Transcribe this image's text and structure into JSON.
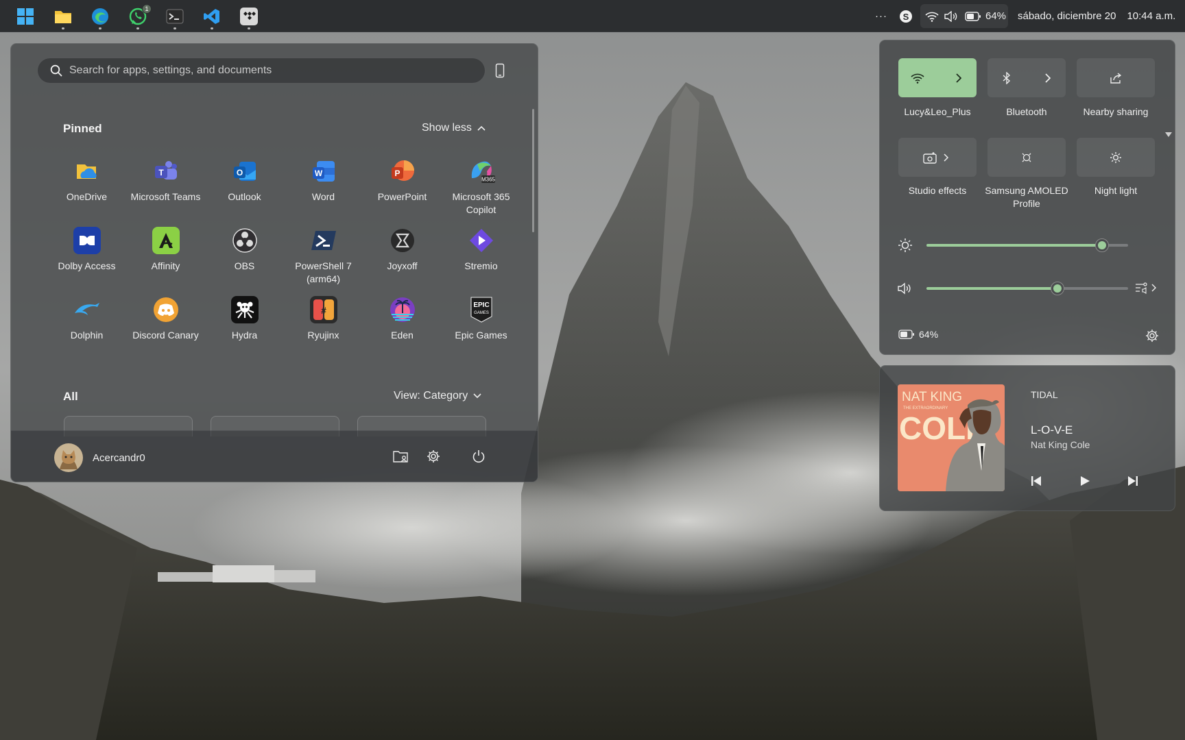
{
  "taskbar": {
    "apps": [
      {
        "name": "Start",
        "icon": "windows-logo-icon"
      },
      {
        "name": "File Explorer",
        "icon": "folder-icon"
      },
      {
        "name": "Microsoft Edge",
        "icon": "edge-icon"
      },
      {
        "name": "WhatsApp",
        "icon": "whatsapp-icon",
        "badge": "1"
      },
      {
        "name": "Terminal",
        "icon": "terminal-icon"
      },
      {
        "name": "Visual Studio Code",
        "icon": "vscode-icon"
      },
      {
        "name": "TIDAL",
        "icon": "tidal-icon"
      }
    ],
    "tray": {
      "overflow": "···",
      "battery_percent": "64%",
      "date": "sábado, diciembre 20",
      "time": "10:44 a.m."
    }
  },
  "start_menu": {
    "search_placeholder": "Search for apps, settings, and documents",
    "pinned_title": "Pinned",
    "show_less_label": "Show less",
    "pinned_apps": [
      {
        "label": "OneDrive",
        "icon": "onedrive-icon"
      },
      {
        "label": "Microsoft Teams",
        "icon": "teams-icon"
      },
      {
        "label": "Outlook",
        "icon": "outlook-icon"
      },
      {
        "label": "Word",
        "icon": "word-icon"
      },
      {
        "label": "PowerPoint",
        "icon": "powerpoint-icon"
      },
      {
        "label": "Microsoft 365 Copilot",
        "icon": "m365-copilot-icon"
      },
      {
        "label": "Dolby Access",
        "icon": "dolby-icon"
      },
      {
        "label": "Affinity",
        "icon": "affinity-icon"
      },
      {
        "label": "OBS",
        "icon": "obs-icon"
      },
      {
        "label": "PowerShell 7 (arm64)",
        "icon": "powershell-icon"
      },
      {
        "label": "Joyxoff",
        "icon": "joyxoff-icon"
      },
      {
        "label": "Stremio",
        "icon": "stremio-icon"
      },
      {
        "label": "Dolphin",
        "icon": "dolphin-icon"
      },
      {
        "label": "Discord Canary",
        "icon": "discord-icon"
      },
      {
        "label": "Hydra",
        "icon": "hydra-icon"
      },
      {
        "label": "Ryujinx",
        "icon": "ryujinx-icon"
      },
      {
        "label": "Eden",
        "icon": "eden-icon"
      },
      {
        "label": "Epic Games",
        "icon": "epic-games-icon"
      }
    ],
    "all_title": "All",
    "view_label": "View: Category",
    "user_name": "Acercandr0"
  },
  "quick_settings": {
    "tiles": [
      {
        "label": "Lucy&Leo_Plus",
        "icon": "wifi-icon",
        "active": true,
        "has_arrow": true
      },
      {
        "label": "Bluetooth",
        "icon": "bluetooth-icon",
        "active": false,
        "has_arrow": true
      },
      {
        "label": "Nearby sharing",
        "icon": "share-icon",
        "active": false,
        "has_arrow": false
      },
      {
        "label": "Studio effects",
        "icon": "studio-effects-icon",
        "active": false,
        "has_arrow": true
      },
      {
        "label": "Samsung AMOLED Profile",
        "icon": "color-profile-icon",
        "active": false,
        "has_arrow": false
      },
      {
        "label": "Night light",
        "icon": "night-light-icon",
        "active": false,
        "has_arrow": false
      }
    ],
    "brightness": 0.87,
    "volume": 0.65,
    "battery_label": "64%",
    "accent_color": "#9ccd9a"
  },
  "media": {
    "source": "TIDAL",
    "title": "L-O-V-E",
    "artist": "Nat King Cole",
    "album_art_text_top": "NAT KING",
    "album_art_text_sub": "THE EXTRAORDINARY",
    "album_art_text_main": "COLE"
  }
}
